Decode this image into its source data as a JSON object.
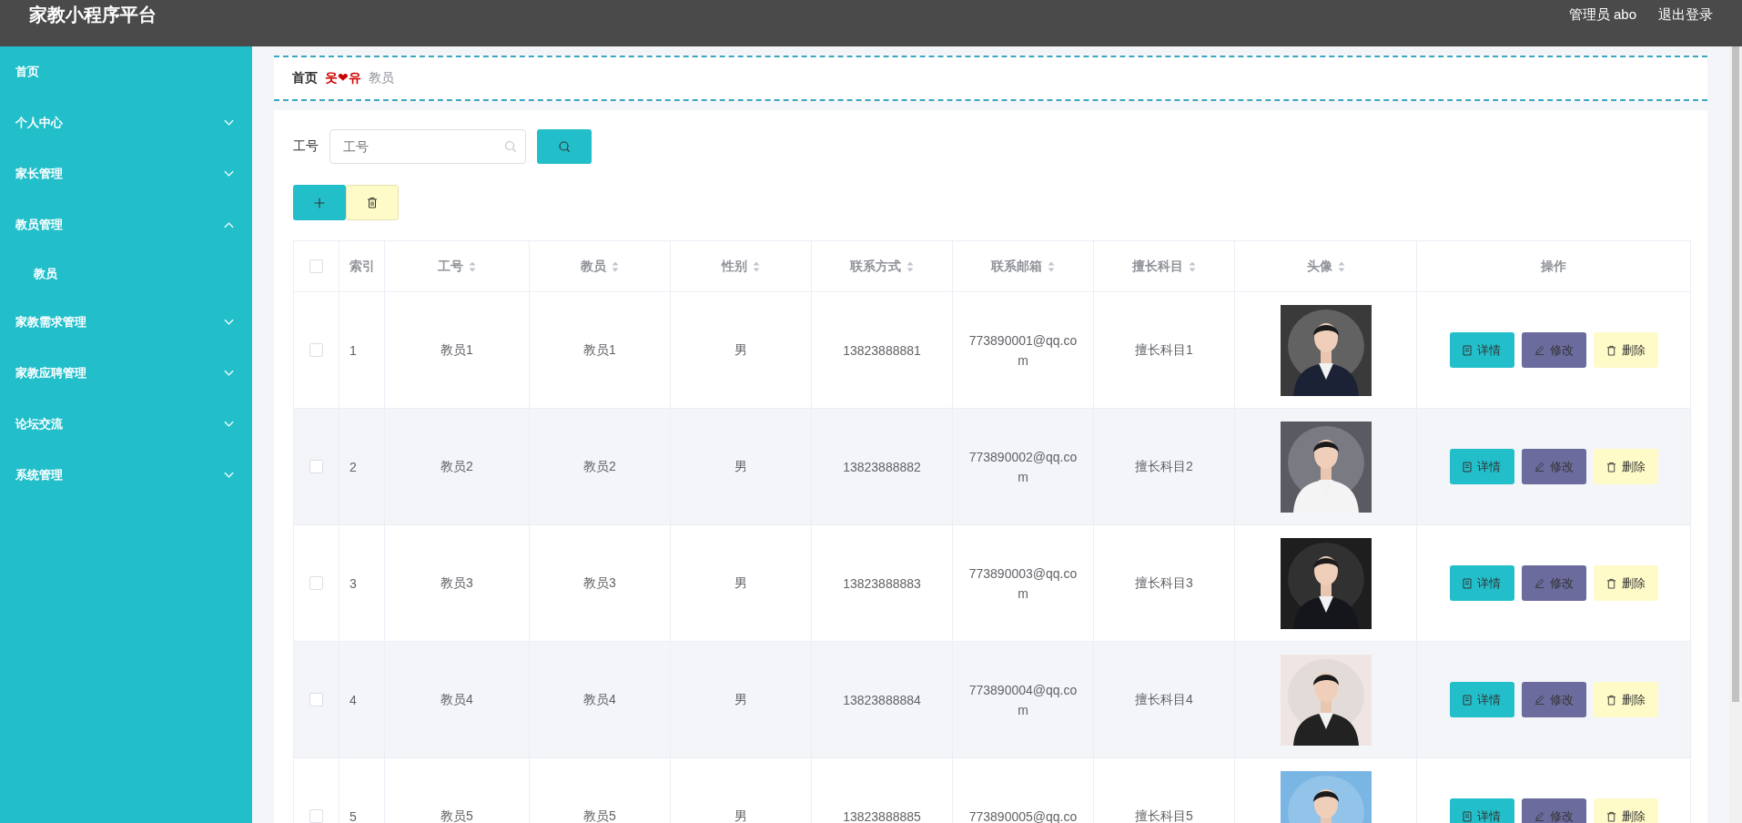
{
  "header": {
    "title": "家教小程序平台",
    "user": "管理员 abo",
    "logout": "退出登录"
  },
  "sidebar": {
    "items": [
      {
        "kind": "link",
        "label": "首页"
      },
      {
        "kind": "group",
        "label": "个人中心",
        "expanded": false
      },
      {
        "kind": "group",
        "label": "家长管理",
        "expanded": false
      },
      {
        "kind": "group",
        "label": "教员管理",
        "expanded": true,
        "children": [
          {
            "label": "教员"
          }
        ]
      },
      {
        "kind": "group",
        "label": "家教需求管理",
        "expanded": false
      },
      {
        "kind": "group",
        "label": "家教应聘管理",
        "expanded": false
      },
      {
        "kind": "group",
        "label": "论坛交流",
        "expanded": false
      },
      {
        "kind": "group",
        "label": "系统管理",
        "expanded": false
      }
    ]
  },
  "breadcrumb": {
    "home": "首页",
    "separator": "웃❤유",
    "current": "教员"
  },
  "search": {
    "label": "工号",
    "placeholder": "工号"
  },
  "table": {
    "header_checked": false,
    "columns": [
      {
        "label": "索引",
        "sortable": false
      },
      {
        "label": "工号",
        "sortable": true
      },
      {
        "label": "教员",
        "sortable": true
      },
      {
        "label": "性别",
        "sortable": true
      },
      {
        "label": "联系方式",
        "sortable": true
      },
      {
        "label": "联系邮箱",
        "sortable": true
      },
      {
        "label": "擅长科目",
        "sortable": true
      },
      {
        "label": "头像",
        "sortable": true
      },
      {
        "label": "操作",
        "sortable": false
      }
    ],
    "rows": [
      {
        "checked": false,
        "index": "1",
        "id": "教员1",
        "name": "教员1",
        "gender": "男",
        "phone": "13823888881",
        "email": "773890001@qq.com",
        "subject": "擅长科目1",
        "actions": [
          {
            "kind": "detail",
            "label": "详情"
          },
          {
            "kind": "edit",
            "label": "修改"
          },
          {
            "kind": "delete",
            "label": "删除"
          }
        ]
      },
      {
        "checked": false,
        "index": "2",
        "id": "教员2",
        "name": "教员2",
        "gender": "男",
        "phone": "13823888882",
        "email": "773890002@qq.com",
        "subject": "擅长科目2",
        "actions": [
          {
            "kind": "detail",
            "label": "详情"
          },
          {
            "kind": "edit",
            "label": "修改"
          },
          {
            "kind": "delete",
            "label": "删除"
          }
        ]
      },
      {
        "checked": false,
        "index": "3",
        "id": "教员3",
        "name": "教员3",
        "gender": "男",
        "phone": "13823888883",
        "email": "773890003@qq.com",
        "subject": "擅长科目3",
        "actions": [
          {
            "kind": "detail",
            "label": "详情"
          },
          {
            "kind": "edit",
            "label": "修改"
          },
          {
            "kind": "delete",
            "label": "删除"
          }
        ]
      },
      {
        "checked": false,
        "index": "4",
        "id": "教员4",
        "name": "教员4",
        "gender": "男",
        "phone": "13823888884",
        "email": "773890004@qq.com",
        "subject": "擅长科目4",
        "actions": [
          {
            "kind": "detail",
            "label": "详情"
          },
          {
            "kind": "edit",
            "label": "修改"
          },
          {
            "kind": "delete",
            "label": "删除"
          }
        ]
      },
      {
        "checked": false,
        "index": "5",
        "id": "教员5",
        "name": "教员5",
        "gender": "男",
        "phone": "13823888885",
        "email": "773890005@qq.co",
        "subject": "擅长科目5",
        "actions": [
          {
            "kind": "detail",
            "label": "详情"
          },
          {
            "kind": "edit",
            "label": "修改"
          },
          {
            "kind": "delete",
            "label": "删除"
          }
        ]
      }
    ]
  }
}
